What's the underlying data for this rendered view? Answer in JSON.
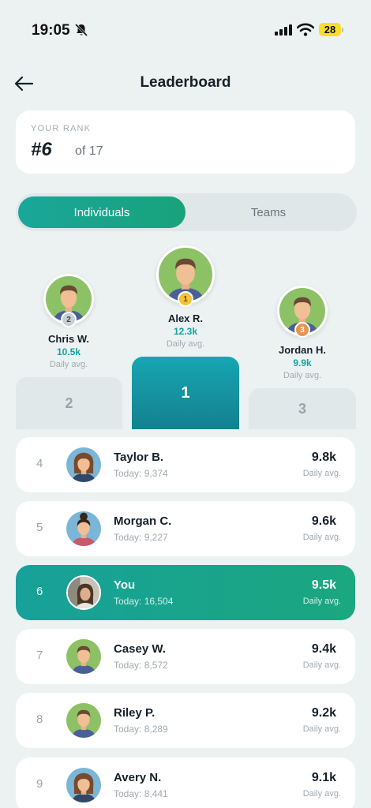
{
  "status": {
    "time": "19:05",
    "battery": "28"
  },
  "header": {
    "title": "Leaderboard"
  },
  "rank_card": {
    "label": "YOUR RANK",
    "rank": "#6",
    "of": "of 17"
  },
  "tabs": [
    {
      "label": "Individuals",
      "active": true
    },
    {
      "label": "Teams",
      "active": false
    }
  ],
  "podium": {
    "first": {
      "place": "1",
      "name": "Alex R.",
      "score": "12.3k",
      "sub": "Daily avg.",
      "block": "1"
    },
    "second": {
      "place": "2",
      "name": "Chris W.",
      "score": "10.5k",
      "sub": "Daily avg.",
      "block": "2"
    },
    "third": {
      "place": "3",
      "name": "Jordan H.",
      "score": "9.9k",
      "sub": "Daily avg.",
      "block": "3"
    }
  },
  "rows": [
    {
      "rank": "4",
      "name": "Taylor B.",
      "today": "Today: 9,374",
      "score": "9.8k",
      "avg": "Daily avg.",
      "avatar": "female-avatar"
    },
    {
      "rank": "5",
      "name": "Morgan C.",
      "today": "Today: 9,227",
      "score": "9.6k",
      "avg": "Daily avg.",
      "avatar": "female-avatar"
    },
    {
      "rank": "6",
      "name": "You",
      "today": "Today: 16,504",
      "score": "9.5k",
      "avg": "Daily avg.",
      "avatar": "photo-avatar"
    },
    {
      "rank": "7",
      "name": "Casey W.",
      "today": "Today: 8,572",
      "score": "9.4k",
      "avg": "Daily avg.",
      "avatar": "male-avatar"
    },
    {
      "rank": "8",
      "name": "Riley P.",
      "today": "Today: 8,289",
      "score": "9.2k",
      "avg": "Daily avg.",
      "avatar": "male-avatar"
    },
    {
      "rank": "9",
      "name": "Avery N.",
      "today": "Today: 8,441",
      "score": "9.1k",
      "avg": "Daily avg.",
      "avatar": "female-avatar"
    }
  ],
  "colors": {
    "accent": "#17a49a",
    "accent_text": "#16a2a0",
    "gold": "#f2c43a",
    "silver": "#c9cfd3",
    "bronze": "#e8954d"
  }
}
